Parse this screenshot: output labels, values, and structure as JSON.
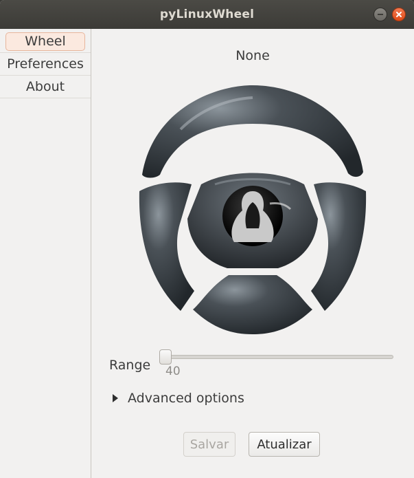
{
  "window": {
    "title": "pyLinuxWheel",
    "minimize_icon": "minimize-icon",
    "close_icon": "close-icon"
  },
  "sidebar": {
    "tabs": [
      {
        "label": "Wheel",
        "active": true
      },
      {
        "label": "Preferences",
        "active": false
      },
      {
        "label": "About",
        "active": false
      }
    ]
  },
  "main": {
    "wheel_name": "None",
    "wheel_image_icon": "steering-wheel-tux-icon",
    "range": {
      "label": "Range",
      "value": "40",
      "position_fraction": 0.0
    },
    "advanced": {
      "label": "Advanced options",
      "expanded": false
    },
    "buttons": {
      "save_label": "Salvar",
      "save_enabled": false,
      "update_label": "Atualizar"
    }
  },
  "colors": {
    "titlebar": "#3c3b37",
    "close_button": "#e95420",
    "active_tab_bg": "#fbe9df",
    "wheel_body": "#3b4045"
  }
}
